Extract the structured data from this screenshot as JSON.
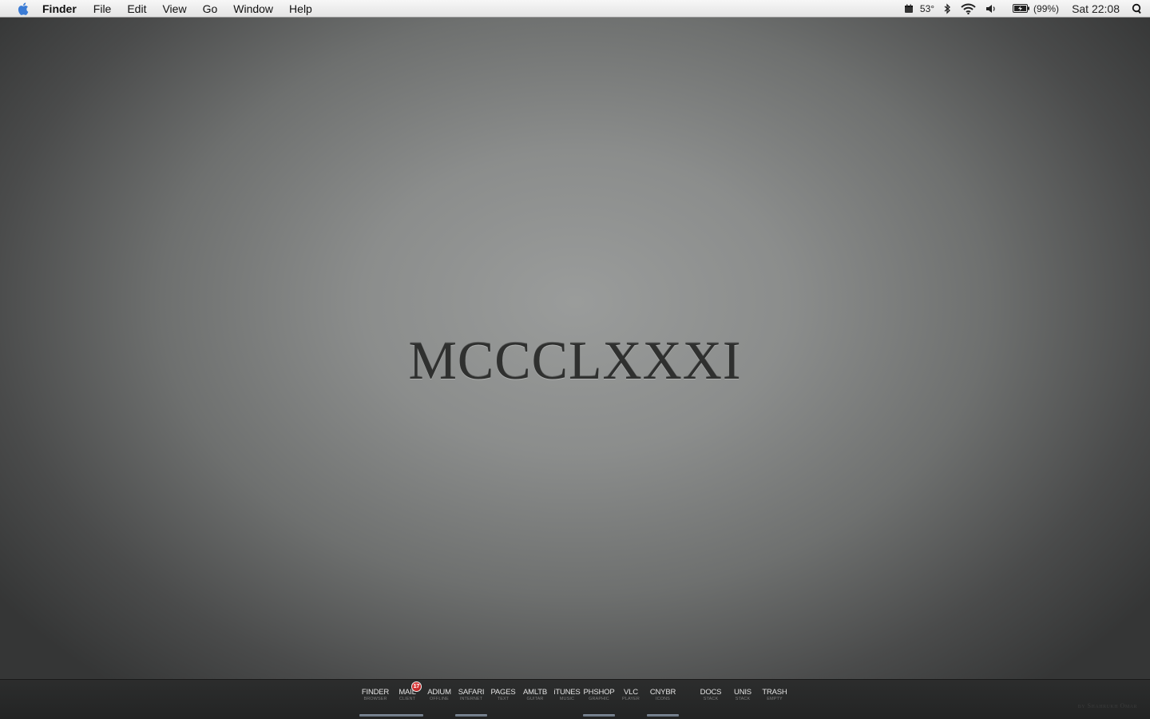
{
  "menubar": {
    "apple_icon": "apple-logo-icon",
    "app_name": "Finder",
    "items": [
      "File",
      "Edit",
      "View",
      "Go",
      "Window",
      "Help"
    ],
    "status": {
      "weather_icon": "weather-icon",
      "temperature": "53°",
      "bluetooth_icon": "bluetooth-icon",
      "wifi_icon": "wifi-icon",
      "volume_icon": "volume-icon",
      "battery_icon": "battery-icon",
      "battery_percent": "(99%)",
      "clock": "Sat 22:08",
      "spotlight_icon": "spotlight-search-icon"
    }
  },
  "desktop": {
    "title": "MCCCLXXXI",
    "signature": "by Shahrukh Omar"
  },
  "dock": {
    "items": [
      {
        "name": "FINDER",
        "sub": "BROWSER",
        "running": true
      },
      {
        "name": "MAIL",
        "sub": "CLIENT",
        "badge": "17",
        "running": true
      },
      {
        "name": "ADIUM",
        "sub": "OFFLINE",
        "running": false
      },
      {
        "name": "SAFARI",
        "sub": "INTERNET",
        "running": true
      },
      {
        "name": "PAGES",
        "sub": "TEXT",
        "running": false
      },
      {
        "name": "AMLTB",
        "sub": "GUITAR",
        "running": false
      },
      {
        "name": "iTUNES",
        "sub": "MUSIC",
        "running": false
      },
      {
        "name": "PHSHOP",
        "sub": "GRAPHIC",
        "running": true
      },
      {
        "name": "VLC",
        "sub": "PLAYER",
        "running": false
      },
      {
        "name": "CNYBR",
        "sub": "ICONS",
        "running": true
      },
      {
        "name": "DOCS",
        "sub": "STACK",
        "running": false
      },
      {
        "name": "UNIS",
        "sub": "STACK",
        "running": false
      },
      {
        "name": "TRASH",
        "sub": "EMPTY",
        "running": false
      }
    ]
  }
}
